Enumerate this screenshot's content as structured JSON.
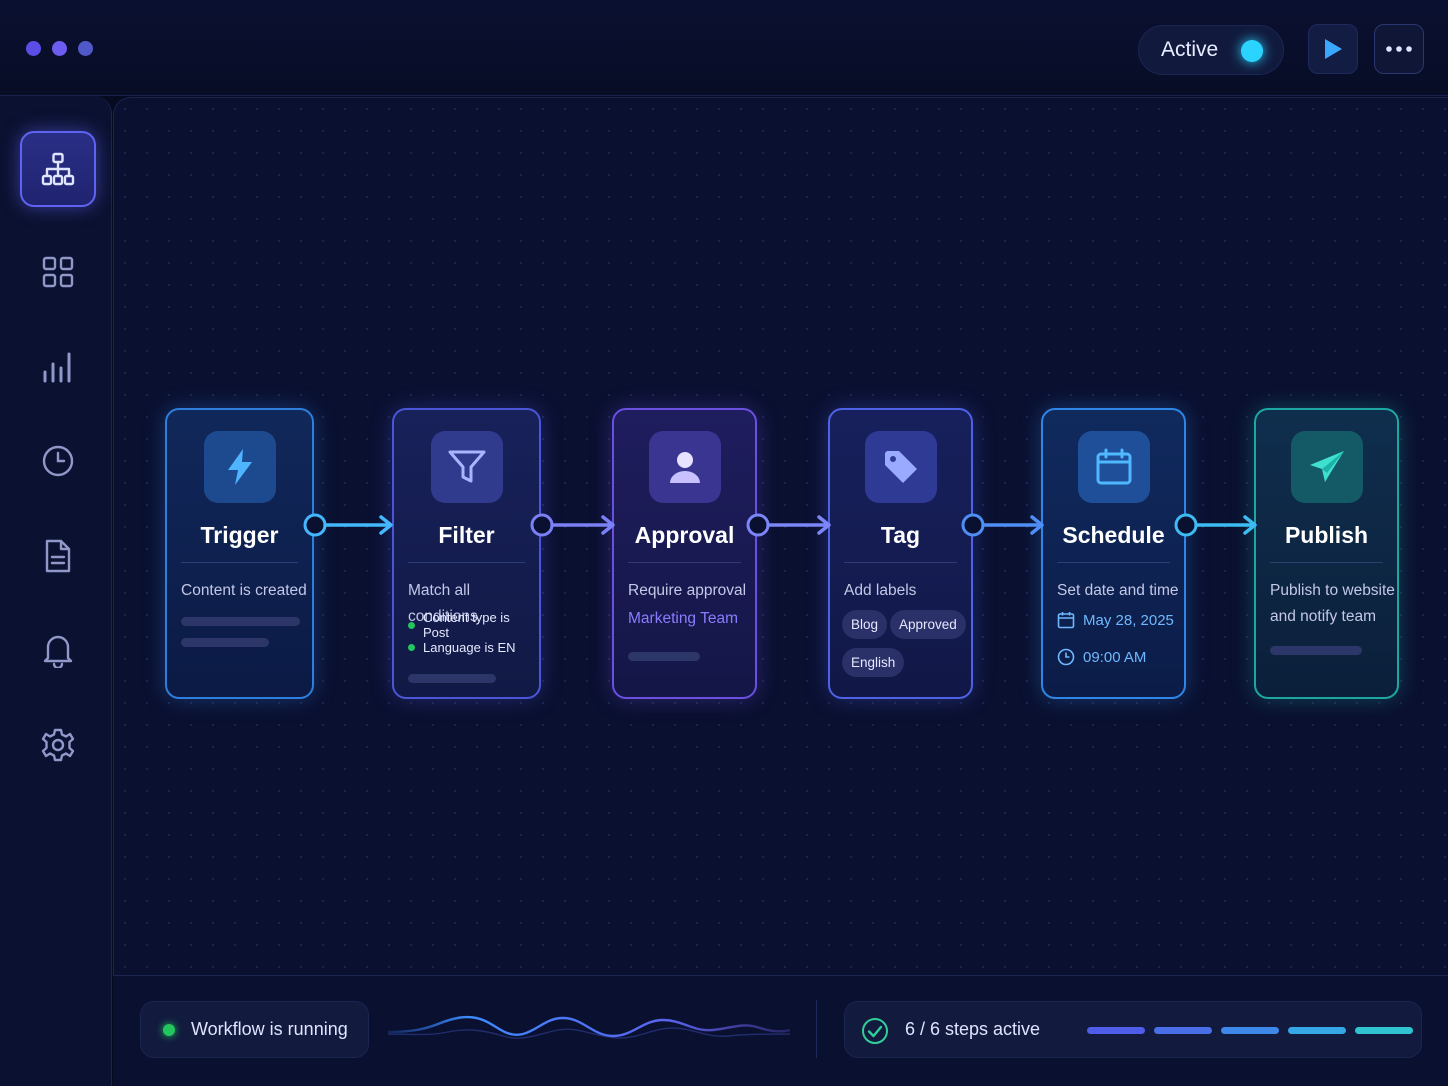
{
  "window": {
    "dot_colors": [
      "#5b4ee6",
      "#6c5cf0",
      "#4f59c9"
    ]
  },
  "header": {
    "status_label": "Active",
    "status_color": "#2bd3ff",
    "play_icon": "play-icon",
    "more_icon": "more-horizontal-icon"
  },
  "sidebar": {
    "items": [
      {
        "icon": "workflow-icon",
        "active": true
      },
      {
        "icon": "grid-icon",
        "active": false
      },
      {
        "icon": "bar-chart-icon",
        "active": false
      },
      {
        "icon": "clock-icon",
        "active": false
      },
      {
        "icon": "document-icon",
        "active": false
      },
      {
        "icon": "bell-icon",
        "active": false
      },
      {
        "icon": "gear-icon",
        "active": false
      }
    ]
  },
  "workflow": {
    "steps": [
      {
        "title": "Trigger",
        "description": "Content is created",
        "icon": "lightning-icon",
        "accent": "#2e7fdc"
      },
      {
        "title": "Filter",
        "description": "Match all conditions",
        "icon": "filter-icon",
        "accent": "#4a55d8",
        "conditions": [
          "Content type is Post",
          "Language is EN"
        ]
      },
      {
        "title": "Approval",
        "description": "Require approval",
        "icon": "user-icon",
        "accent": "#6a4fe0",
        "assignee": "Marketing Team"
      },
      {
        "title": "Tag",
        "description": "Add labels",
        "icon": "tag-icon",
        "accent": "#4d62e6",
        "labels": [
          "Blog",
          "Approved",
          "English"
        ]
      },
      {
        "title": "Schedule",
        "description": "Set date and time",
        "icon": "calendar-icon",
        "accent": "#2f86e6",
        "date": "May 28, 2025",
        "time": "09:00 AM"
      },
      {
        "title": "Publish",
        "description_line1": "Publish to website",
        "description_line2": "and notify team",
        "icon": "send-icon",
        "accent": "#1ea7a0"
      }
    ]
  },
  "footer": {
    "running_label": "Workflow is running",
    "running_color": "#22c55e",
    "steps_label": "6 / 6 steps active",
    "steps_active": 6,
    "steps_total": 6,
    "segment_colors": [
      "#4f5de8",
      "#4a6ee8",
      "#3e88ea",
      "#36a7e6",
      "#2fc4cf"
    ]
  }
}
